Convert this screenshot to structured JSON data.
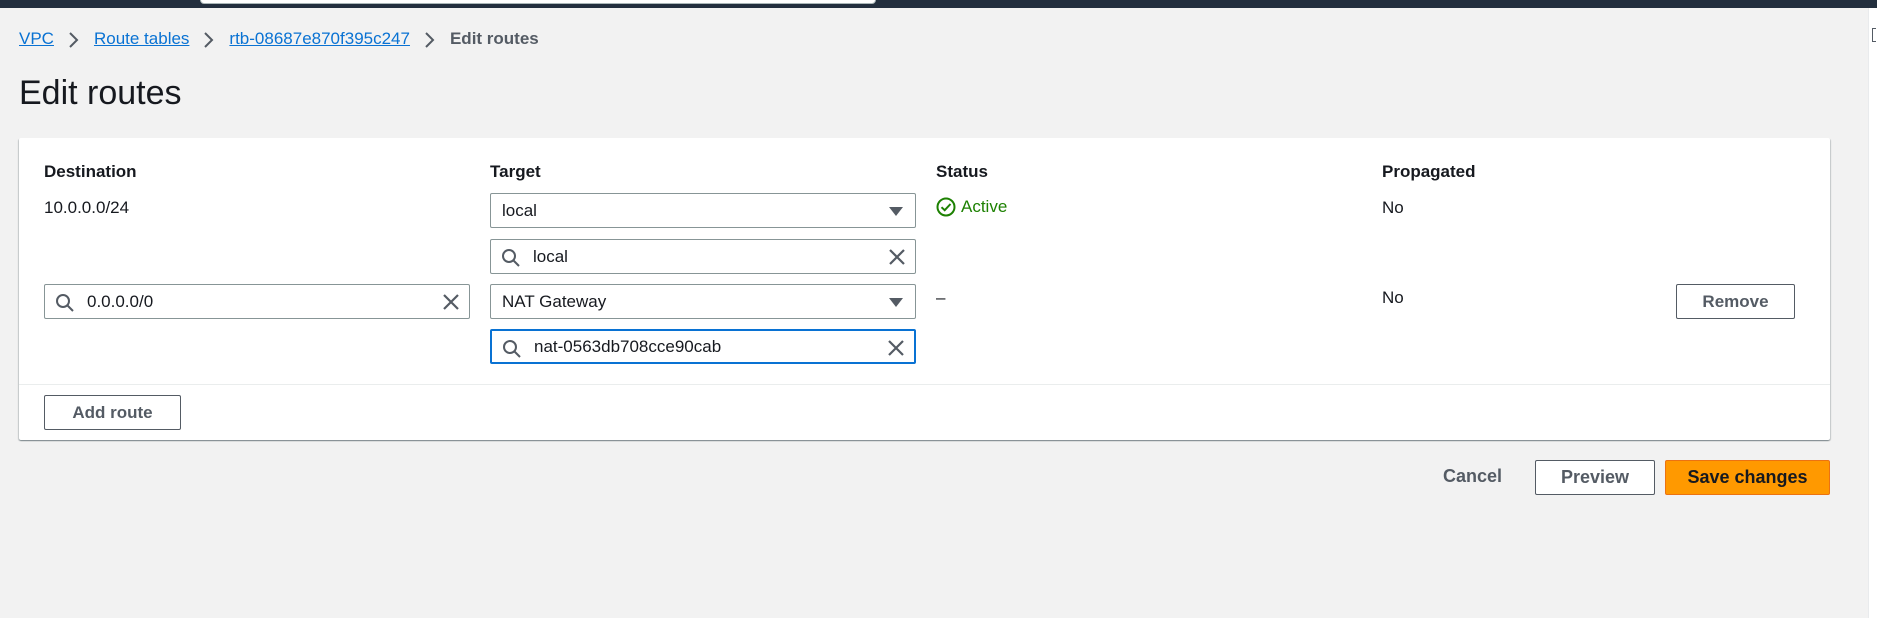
{
  "breadcrumb": {
    "items": [
      "VPC",
      "Route tables",
      "rtb-08687e870f395c247"
    ],
    "current": "Edit routes"
  },
  "page": {
    "title": "Edit routes"
  },
  "table": {
    "headers": {
      "destination": "Destination",
      "target": "Target",
      "status": "Status",
      "propagated": "Propagated"
    },
    "rows": [
      {
        "destination": "10.0.0.0/24",
        "target_type": "local",
        "target_search": "local",
        "status": "Active",
        "propagated": "No"
      },
      {
        "destination": "0.0.0.0/0",
        "target_type": "NAT Gateway",
        "target_search": "nat-0563db708cce90cab",
        "status": "–",
        "propagated": "No",
        "remove_label": "Remove"
      }
    ]
  },
  "actions": {
    "add_route": "Add route",
    "cancel": "Cancel",
    "preview": "Preview",
    "save": "Save changes"
  },
  "colors": {
    "link": "#0972d3",
    "active_status": "#1d8102",
    "primary_button": "#ff9900",
    "focus_border": "#0972d3"
  },
  "icons": [
    "chevron-right-icon",
    "search-icon",
    "clear-icon",
    "caret-down-icon",
    "status-success-icon"
  ]
}
